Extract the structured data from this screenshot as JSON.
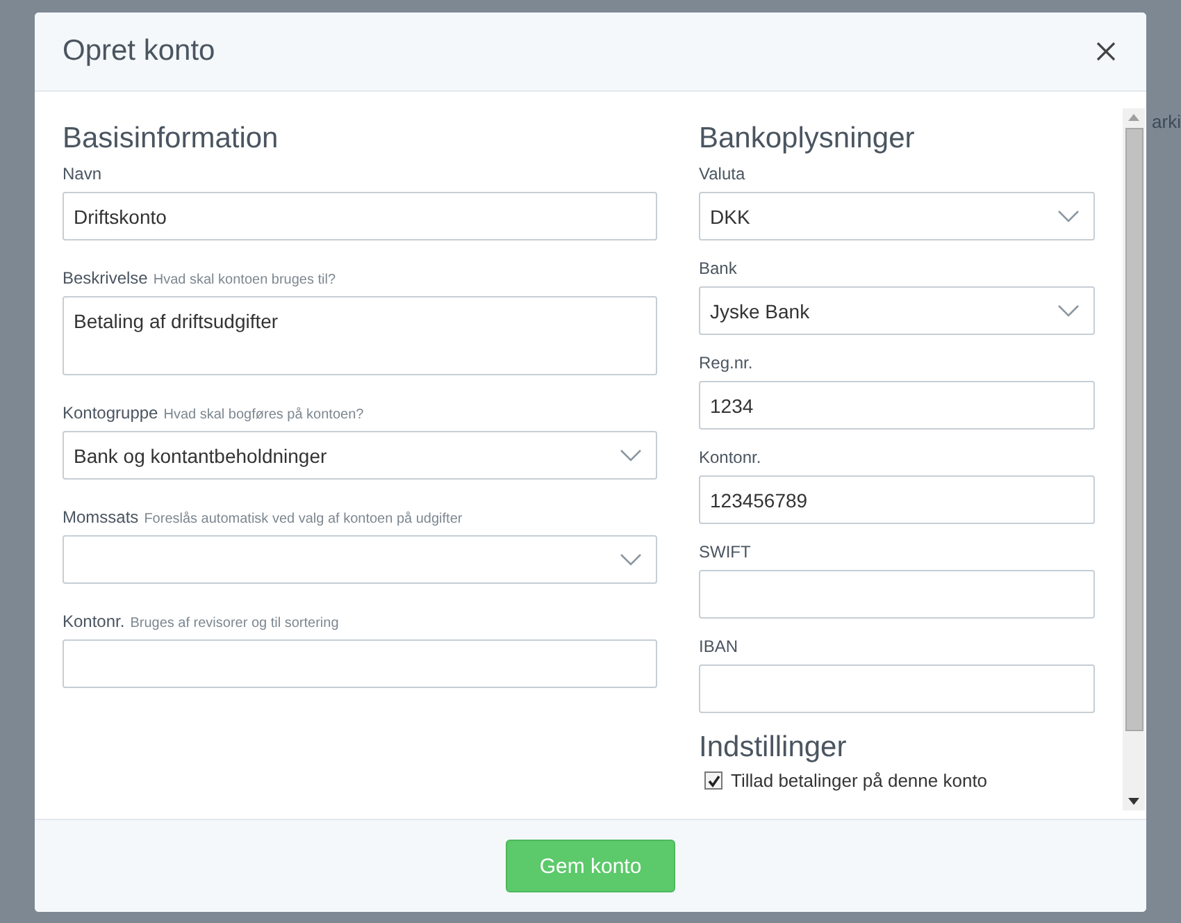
{
  "background": {
    "texts": [
      "arki"
    ]
  },
  "dialog": {
    "title": "Opret konto",
    "left": {
      "heading": "Basisinformation",
      "fields": [
        {
          "label": "Navn",
          "kind": "text",
          "value": "Driftskonto"
        },
        {
          "label": "Beskrivelse",
          "hint": "Hvad skal kontoen bruges til?",
          "kind": "textarea",
          "value": "Betaling af driftsudgifter"
        },
        {
          "label": "Kontogruppe",
          "hint": "Hvad skal bogføres på kontoen?",
          "kind": "select",
          "value": "Bank og kontantbeholdninger"
        },
        {
          "label": "Momssats",
          "hint": "Foreslås automatisk ved valg af kontoen på udgifter",
          "kind": "select"
        },
        {
          "label": "Kontonr.",
          "hint": "Bruges af revisorer og til sortering",
          "kind": "text"
        }
      ]
    },
    "right": {
      "heading": "Bankoplysninger",
      "fields": [
        {
          "label": "Valuta",
          "kind": "select",
          "value": "DKK"
        },
        {
          "label": "Bank",
          "kind": "select",
          "value": "Jyske Bank"
        },
        {
          "label": "Reg.nr.",
          "kind": "text",
          "value": "1234"
        },
        {
          "label": "Kontonr.",
          "kind": "text",
          "value": "123456789"
        },
        {
          "label": "SWIFT",
          "kind": "text"
        },
        {
          "label": "IBAN",
          "kind": "text"
        }
      ]
    },
    "settings": {
      "heading": "Indstillinger",
      "checkboxes": [
        {
          "label": "Tillad betalinger på denne konto",
          "checked": true
        }
      ]
    },
    "save_button": "Gem konto"
  }
}
